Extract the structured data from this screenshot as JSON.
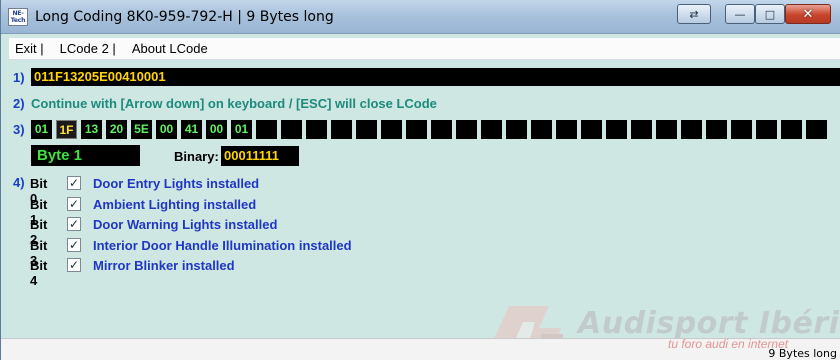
{
  "window": {
    "title": "Long Coding  8K0-959-792-H | 9 Bytes long",
    "app_icon_text": "NE-Tech"
  },
  "menu": {
    "items": [
      "Exit |",
      "LCode 2 |",
      "About LCode"
    ]
  },
  "step_numbers": [
    "1)",
    "2)",
    "3)",
    "4)"
  ],
  "coding": {
    "hex_string": "011F13205E00410001",
    "instruction": "Continue with [Arrow down] on keyboard / [ESC] will close LCode",
    "bytes": [
      "01",
      "1F",
      "13",
      "20",
      "5E",
      "00",
      "41",
      "00",
      "01",
      "",
      "",
      "",
      "",
      "",
      "",
      "",
      "",
      "",
      "",
      "",
      "",
      "",
      "",
      "",
      "",
      "",
      "",
      "",
      "",
      "",
      "",
      ""
    ],
    "selected_byte_index": 1,
    "byte_label": "Byte 1",
    "binary_label": "Binary:",
    "binary_value": "00011111"
  },
  "bits": [
    {
      "label": "Bit 0",
      "checked": true,
      "text": "Door Entry Lights installed"
    },
    {
      "label": "Bit 1",
      "checked": true,
      "text": "Ambient Lighting installed"
    },
    {
      "label": "Bit 2",
      "checked": true,
      "text": "Door Warning Lights installed"
    },
    {
      "label": "Bit 3",
      "checked": true,
      "text": "Interior Door Handle Illumination installed"
    },
    {
      "label": "Bit 4",
      "checked": true,
      "text": "Mirror Blinker installed"
    }
  ],
  "checkmark": "✓",
  "status": {
    "text": "9 Bytes long"
  },
  "watermark": {
    "logo_text": "A",
    "title": "Audisport Ibérica",
    "subtitle": "tu foro audi en internet"
  },
  "colors": {
    "background": "#cfe7e2",
    "hex_text": "#ffd400",
    "byte_text": "#5ff25f",
    "bit_text": "#2036c4",
    "instruction": "#1c8a7c"
  }
}
